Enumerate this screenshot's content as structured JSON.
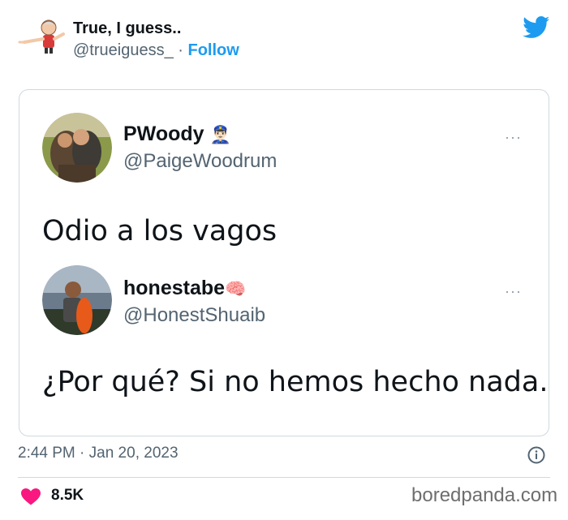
{
  "author": {
    "name": "True, I guess..",
    "handle": "@trueiguess_",
    "separator": "·",
    "follow_label": "Follow"
  },
  "quoted_tweets": [
    {
      "name": "PWoody",
      "badge_emoji": "👮🏻‍♂️",
      "handle": "@PaigeWoodrum",
      "more": "···",
      "text": "Odio a los vagos"
    },
    {
      "name": "honestabe",
      "badge_emoji": "🧠",
      "handle": "@HonestShuaib",
      "more": "···",
      "text": "¿Por qué? Si no hemos hecho nada."
    }
  ],
  "meta": {
    "timestamp": "2:44 PM · Jan 20, 2023",
    "likes": "8.5K"
  },
  "watermark": "boredpanda.com",
  "colors": {
    "accent": "#1d9bf0",
    "like": "#f91880",
    "secondary_text": "#536471"
  }
}
